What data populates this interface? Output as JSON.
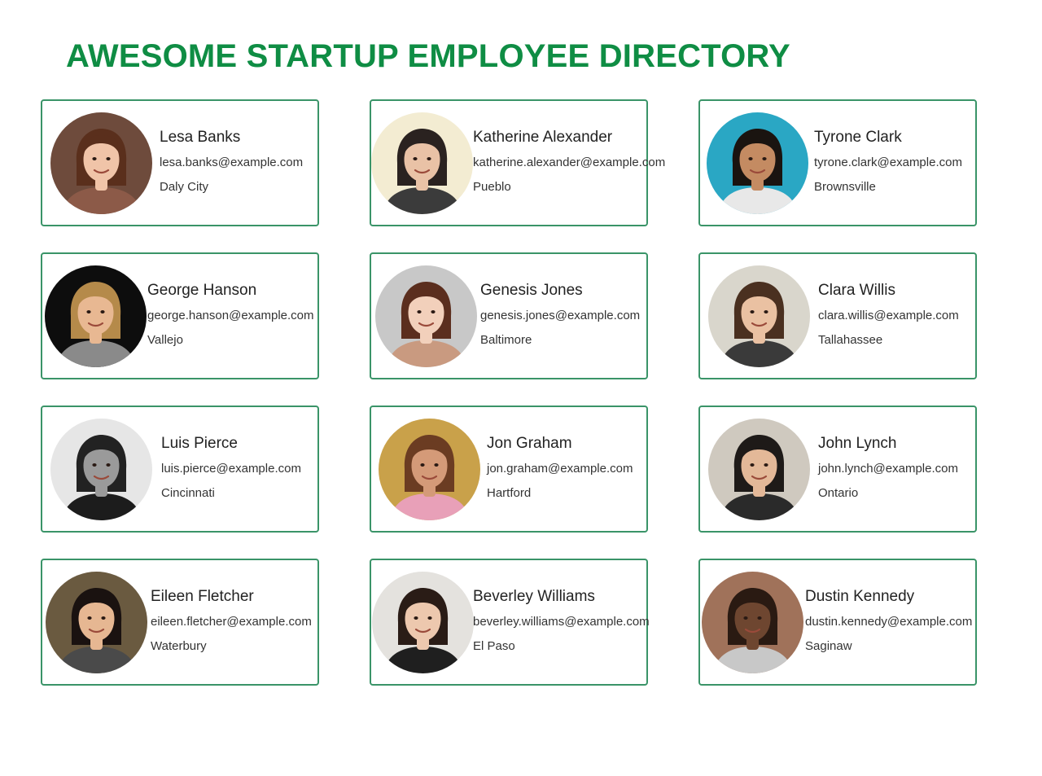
{
  "header": {
    "title": "AWESOME STARTUP EMPLOYEE DIRECTORY"
  },
  "colors": {
    "title": "#0f8d44",
    "card_border": "#3a9468"
  },
  "employees": [
    {
      "name": "Lesa Banks",
      "email": "lesa.banks@example.com",
      "city": "Daly City",
      "photo": {
        "bg": "#6e4b3c",
        "skin": "#f0c4a8",
        "hair": "#5a2f1c",
        "shirt": "#8c5a48"
      }
    },
    {
      "name": "Katherine Alexander",
      "email": "katherine.alexander@example.com",
      "city": "Pueblo",
      "photo": {
        "bg": "#f3ecd2",
        "skin": "#e9c2a6",
        "hair": "#2a2220",
        "shirt": "#3b3b3b"
      }
    },
    {
      "name": "Tyrone Clark",
      "email": "tyrone.clark@example.com",
      "city": "Brownsville",
      "photo": {
        "bg": "#2aa7c4",
        "skin": "#c48b62",
        "hair": "#1a1410",
        "shirt": "#e8e8e8"
      }
    },
    {
      "name": "George Hanson",
      "email": "george.hanson@example.com",
      "city": "Vallejo",
      "photo": {
        "bg": "#0d0d0d",
        "skin": "#e8b892",
        "hair": "#b58a4a",
        "shirt": "#8a8a8a"
      }
    },
    {
      "name": "Genesis Jones",
      "email": "genesis.jones@example.com",
      "city": "Baltimore",
      "photo": {
        "bg": "#c8c8c8",
        "skin": "#f2d0bb",
        "hair": "#5b2e1e",
        "shirt": "#c99a80"
      }
    },
    {
      "name": "Clara Willis",
      "email": "clara.willis@example.com",
      "city": "Tallahassee",
      "photo": {
        "bg": "#d9d6cc",
        "skin": "#eac1a2",
        "hair": "#4a3020",
        "shirt": "#3a3a3a"
      }
    },
    {
      "name": "Luis Pierce",
      "email": "luis.pierce@example.com",
      "city": "Cincinnati",
      "photo": {
        "bg": "#e6e6e6",
        "skin": "#9a9a9a",
        "hair": "#222222",
        "shirt": "#1c1c1c"
      }
    },
    {
      "name": "Jon Graham",
      "email": "jon.graham@example.com",
      "city": "Hartford",
      "photo": {
        "bg": "#c9a14a",
        "skin": "#d49a78",
        "hair": "#6b3c22",
        "shirt": "#e8a0b8"
      }
    },
    {
      "name": "John Lynch",
      "email": "john.lynch@example.com",
      "city": "Ontario",
      "photo": {
        "bg": "#cfc9bf",
        "skin": "#e3b898",
        "hair": "#1e1a18",
        "shirt": "#2a2a2a"
      }
    },
    {
      "name": "Eileen Fletcher",
      "email": "eileen.fletcher@example.com",
      "city": "Waterbury",
      "photo": {
        "bg": "#6a5a40",
        "skin": "#e6b792",
        "hair": "#1a1210",
        "shirt": "#4a4a4a"
      }
    },
    {
      "name": "Beverley Williams",
      "email": "beverley.williams@example.com",
      "city": "El Paso",
      "photo": {
        "bg": "#e4e2de",
        "skin": "#edc8ae",
        "hair": "#2a1c16",
        "shirt": "#1f1f1f"
      }
    },
    {
      "name": "Dustin Kennedy",
      "email": "dustin.kennedy@example.com",
      "city": "Saginaw",
      "photo": {
        "bg": "#a0725a",
        "skin": "#6e4630",
        "hair": "#2a1a12",
        "shirt": "#c8c8c8"
      }
    }
  ]
}
